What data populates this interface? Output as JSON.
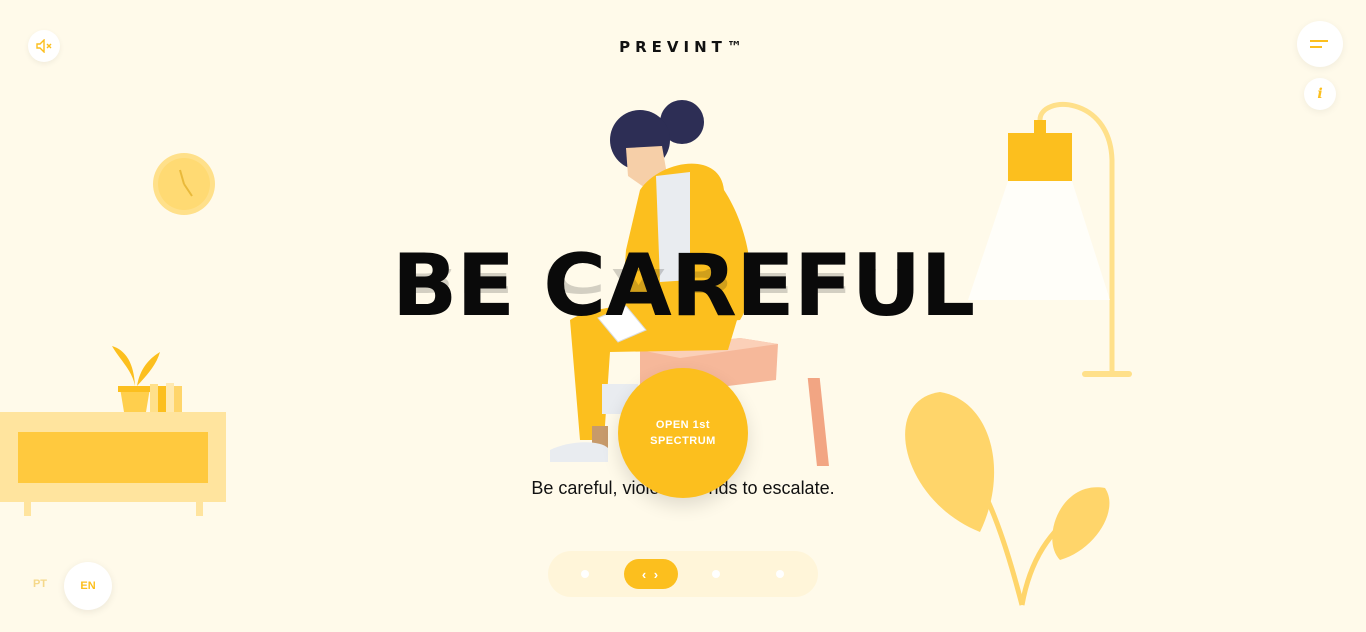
{
  "header": {
    "logo": "PREVINT™",
    "mute_icon": "speaker-muted-icon",
    "menu_icon": "menu-icon",
    "info_label": "i"
  },
  "hero": {
    "headline": "BE CAREFUL",
    "subtitle": "Be careful, violence tends to escalate.",
    "cta_label": "OPEN 1st SPECTRUM"
  },
  "pager": {
    "active_label": "‹ ›",
    "pages": 4,
    "active_index": 1
  },
  "language": {
    "options": [
      "PT",
      "EN"
    ],
    "selected": "EN"
  },
  "colors": {
    "background": "#fffaea",
    "accent": "#fcbf1e",
    "accent_light": "#ffdd7a",
    "text": "#0a0a0a"
  }
}
